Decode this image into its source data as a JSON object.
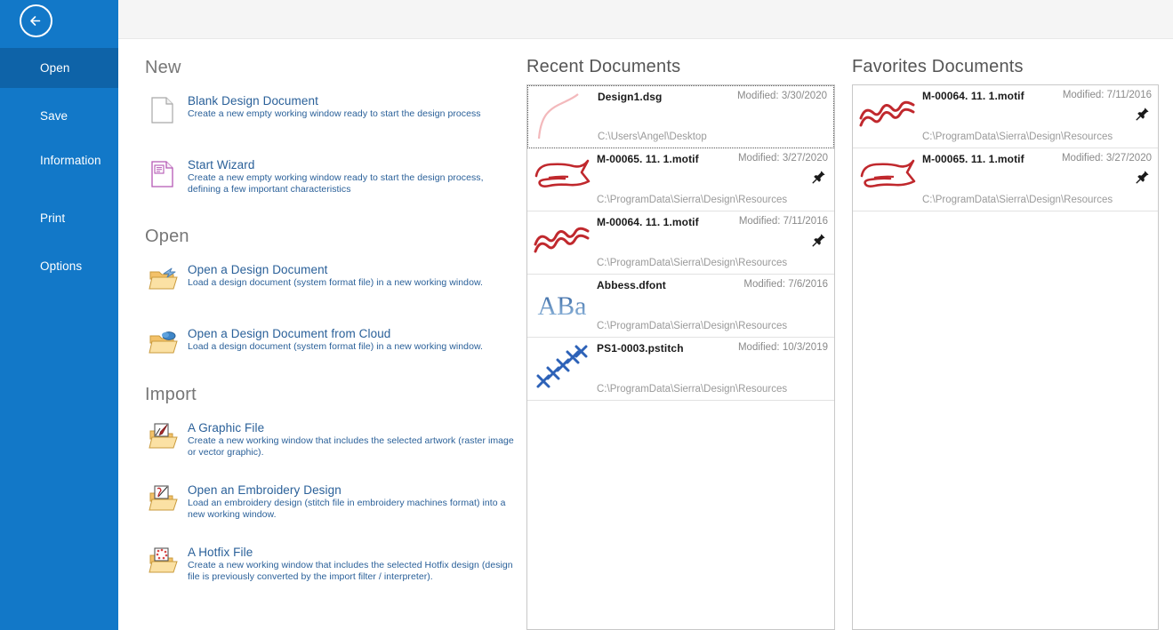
{
  "sidebar": {
    "back_icon": "back-arrow-icon",
    "items": [
      {
        "label": "Open",
        "active": true
      },
      {
        "label": "Save",
        "active": false
      },
      {
        "label": "Information",
        "active": false
      },
      {
        "label": "Print",
        "active": false
      },
      {
        "label": "Options",
        "active": false
      }
    ],
    "color": "#1278c8",
    "active_color": "#0e63a8"
  },
  "groups": [
    {
      "title": "New",
      "commands": [
        {
          "icon": "blank-page-icon",
          "title": "Blank Design Document",
          "description": "Create a new empty working window ready to start the design process"
        },
        {
          "icon": "wizard-page-icon",
          "title": "Start Wizard",
          "description": "Create a new empty working window ready to start the design process, defining a few important characteristics"
        }
      ]
    },
    {
      "title": "Open",
      "commands": [
        {
          "icon": "open-folder-icon",
          "title": "Open a Design Document",
          "description": "Load a design document (system format file) in a new working window."
        },
        {
          "icon": "cloud-folder-icon",
          "title": "Open a Design Document from Cloud",
          "description": "Load a design document (system format file) in a new working window."
        }
      ]
    },
    {
      "title": "Import",
      "commands": [
        {
          "icon": "graphic-file-folder-icon",
          "title": "A Graphic File",
          "description": "Create a new working window that includes the selected artwork (raster image or vector graphic)."
        },
        {
          "icon": "embroidery-folder-icon",
          "title": "Open an Embroidery Design",
          "description": "Load an embroidery design (stitch file in embroidery machines format) into a new working window."
        },
        {
          "icon": "hotfix-folder-icon",
          "title": "A Hotfix File",
          "description": "Create a new working window that includes the selected Hotfix design (design file is previously converted by the import filter / interpreter)."
        }
      ]
    }
  ],
  "recent": {
    "title": "Recent Documents",
    "items": [
      {
        "name": "Design1.dsg",
        "modified": "Modified: 3/30/2020",
        "path": "C:\\Users\\Angel\\Desktop",
        "thumb": "curve-pink-thumb",
        "pinned": false,
        "selected": true
      },
      {
        "name": "M-00065. 11. 1.motif",
        "modified": "Modified: 3/27/2020",
        "path": "C:\\ProgramData\\Sierra\\Design\\Resources",
        "thumb": "ribbon-red-thumb",
        "pinned": true,
        "selected": false
      },
      {
        "name": "M-00064. 11. 1.motif",
        "modified": "Modified: 7/11/2016",
        "path": "C:\\ProgramData\\Sierra\\Design\\Resources",
        "thumb": "wave-red-thumb",
        "pinned": true,
        "selected": false
      },
      {
        "name": "Abbess.dfont",
        "modified": "Modified: 7/6/2016",
        "path": "C:\\ProgramData\\Sierra\\Design\\Resources",
        "thumb": "aba-font-thumb",
        "pinned": false,
        "selected": false
      },
      {
        "name": "PS1-0003.pstitch",
        "modified": "Modified: 10/3/2019",
        "path": "C:\\ProgramData\\Sierra\\Design\\Resources",
        "thumb": "cross-stitch-blue-thumb",
        "pinned": false,
        "selected": false
      }
    ]
  },
  "favorites": {
    "title": "Favorites Documents",
    "items": [
      {
        "name": "M-00064. 11. 1.motif",
        "modified": "Modified: 7/11/2016",
        "path": "C:\\ProgramData\\Sierra\\Design\\Resources",
        "thumb": "wave-red-thumb",
        "pinned": true,
        "selected": false
      },
      {
        "name": "M-00065. 11. 1.motif",
        "modified": "Modified: 3/27/2020",
        "path": "C:\\ProgramData\\Sierra\\Design\\Resources",
        "thumb": "ribbon-red-thumb",
        "pinned": true,
        "selected": false
      }
    ]
  },
  "colors": {
    "accent": "#1278c8",
    "link": "#2a6099",
    "heading": "#777777",
    "motif_red": "#c0282d",
    "stitch_blue": "#2d62b8"
  }
}
